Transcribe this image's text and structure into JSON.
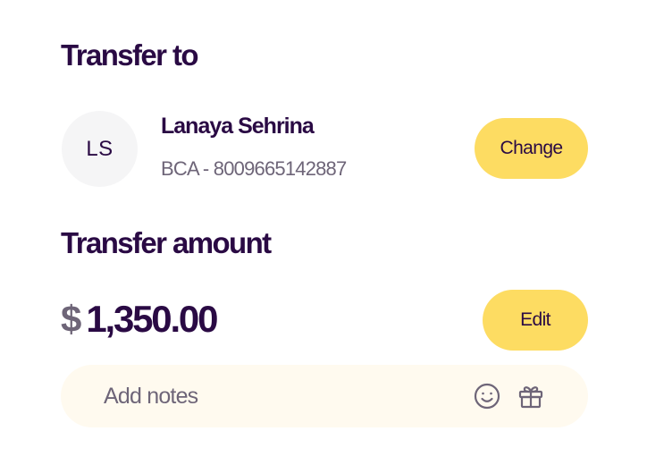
{
  "transfer_to": {
    "title": "Transfer to",
    "recipient": {
      "initials": "LS",
      "name": "Lanaya Sehrina",
      "account": "BCA - 8009665142887"
    },
    "change_label": "Change"
  },
  "transfer_amount": {
    "title": "Transfer amount",
    "currency_symbol": "$",
    "amount": "1,350.00",
    "edit_label": "Edit"
  },
  "notes": {
    "placeholder": "Add notes",
    "icons": [
      "smiley-icon",
      "gift-icon"
    ]
  },
  "colors": {
    "primary_text": "#2a0a44",
    "secondary_text": "#6e6578",
    "button_yellow": "#fddc62",
    "notes_background": "#fffaef",
    "avatar_background": "#f5f5f6"
  }
}
